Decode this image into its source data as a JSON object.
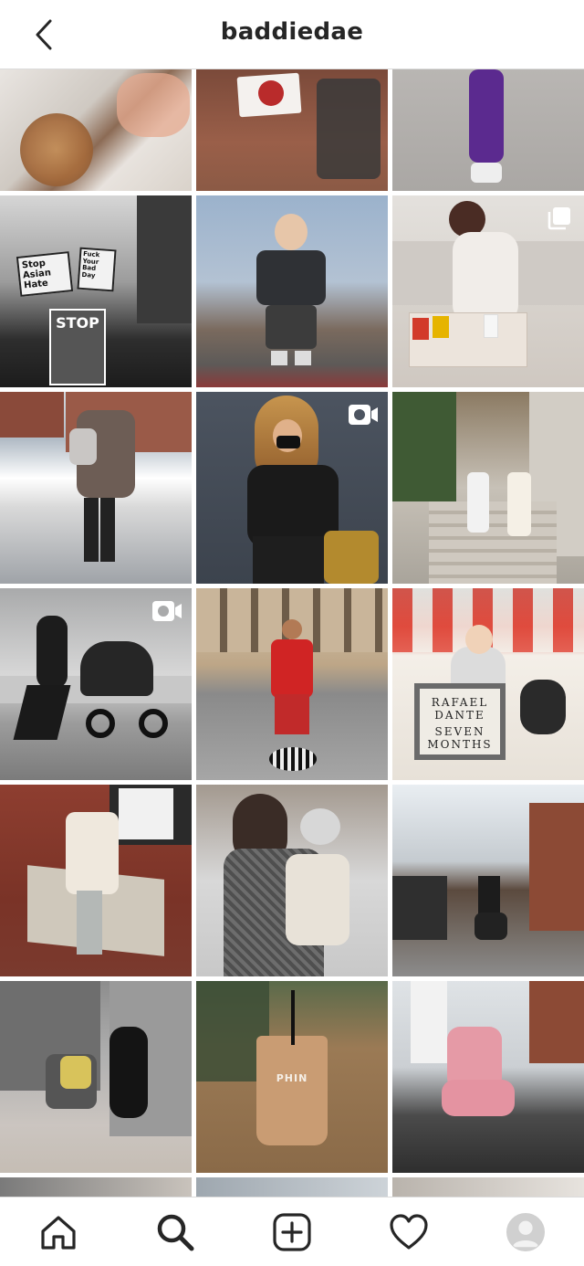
{
  "header": {
    "title": "baddiedae",
    "back_icon": "chevron-left-icon"
  },
  "grid": {
    "posts": [
      {
        "id": "p1",
        "kind": "photo",
        "alt": "latte and shoes"
      },
      {
        "id": "p2",
        "kind": "photo",
        "alt": "stroller sign"
      },
      {
        "id": "p3",
        "kind": "photo",
        "alt": "purple outfit"
      },
      {
        "id": "p4",
        "kind": "photo",
        "alt": "protest signs"
      },
      {
        "id": "p5",
        "kind": "photo",
        "alt": "baby swing"
      },
      {
        "id": "p6",
        "kind": "carousel",
        "alt": "sofa fast food"
      },
      {
        "id": "p7",
        "kind": "photo",
        "alt": "mom baby carrier street"
      },
      {
        "id": "p8",
        "kind": "video",
        "alt": "woman with mask"
      },
      {
        "id": "p9",
        "kind": "photo",
        "alt": "two women stairs"
      },
      {
        "id": "p10",
        "kind": "video",
        "alt": "jogging stroller"
      },
      {
        "id": "p11",
        "kind": "photo",
        "alt": "man on pillar"
      },
      {
        "id": "p12",
        "kind": "photo",
        "alt": "baby seven months"
      },
      {
        "id": "p13",
        "kind": "photo",
        "alt": "woman on stone"
      },
      {
        "id": "p14",
        "kind": "photo",
        "alt": "mom holding baby"
      },
      {
        "id": "p15",
        "kind": "photo",
        "alt": "stroller street"
      },
      {
        "id": "p16",
        "kind": "photo",
        "alt": "snowy stroller"
      },
      {
        "id": "p17",
        "kind": "photo",
        "alt": "iced coffee cup"
      },
      {
        "id": "p18",
        "kind": "photo",
        "alt": "pink sweatsuit"
      }
    ],
    "texts": {
      "sign_stop_asian": "Stop Asian Hate",
      "sign_fuck_bad": "Fuck Your Bad Day",
      "sign_stop": "STOP",
      "letterboard_1": "RAFAEL",
      "letterboard_2": "DANTE",
      "letterboard_3": "SEVEN",
      "letterboard_4": "MONTHS",
      "cup_logo": "PHIN"
    }
  },
  "bottom_nav": {
    "items": [
      {
        "name": "home",
        "icon": "home-icon"
      },
      {
        "name": "search",
        "icon": "search-icon",
        "active": true
      },
      {
        "name": "new-post",
        "icon": "plus-square-icon"
      },
      {
        "name": "activity",
        "icon": "heart-icon"
      },
      {
        "name": "profile",
        "icon": "avatar"
      }
    ]
  },
  "colors": {
    "border": "#dbdbdb",
    "text": "#262626",
    "background": "#ffffff"
  }
}
